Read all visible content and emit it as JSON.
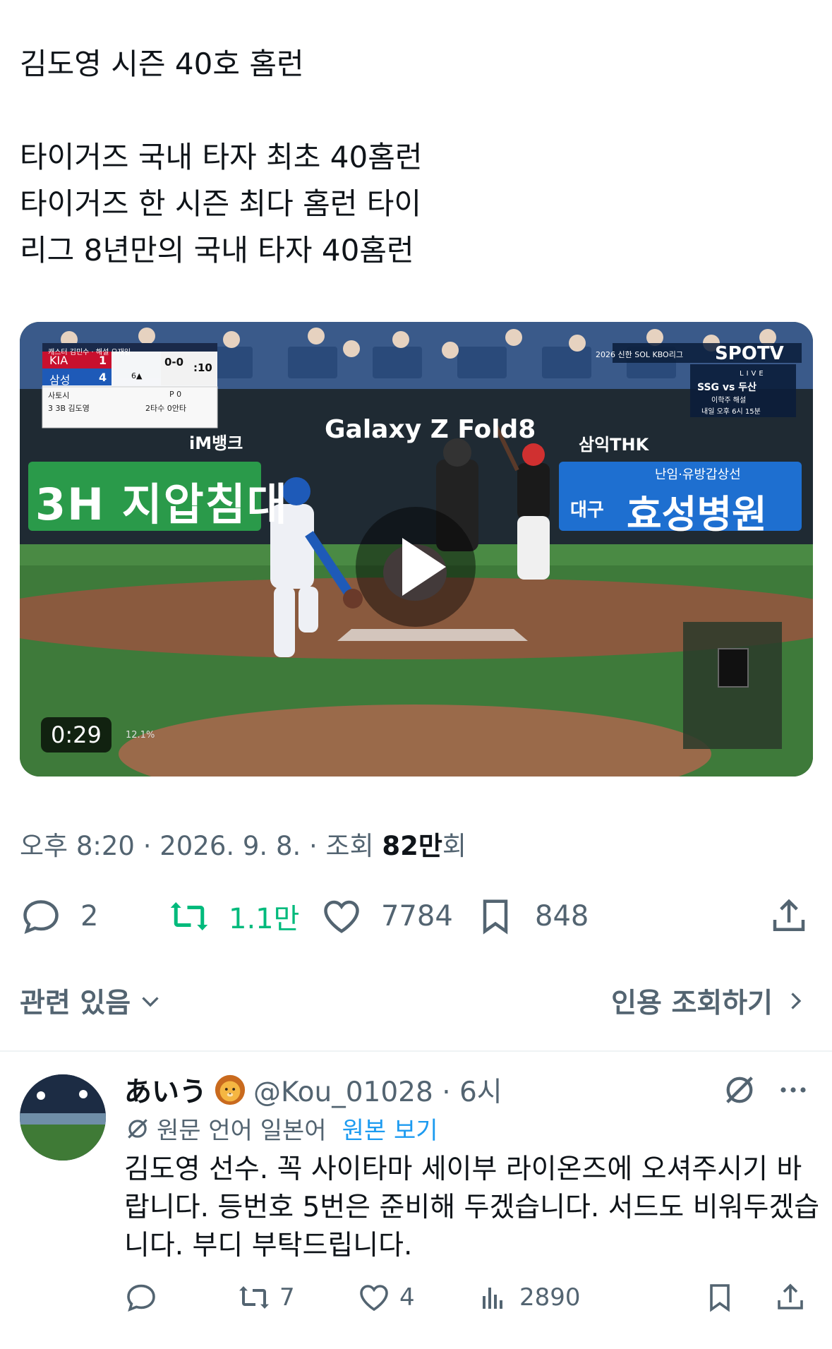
{
  "tweet": {
    "lines": [
      "김도영 시즌 40호 홈런",
      "타이거즈 국내 타자 최초 40홈런",
      "타이거즈 한 시즌 최다 홈런 타이",
      "리그 8년만의 국내 타자 40홈런"
    ],
    "video": {
      "duration": "0:29",
      "scoreboard": {
        "caster_line": "캐스터 김민수 · 해설 오재일",
        "team1": "KIA",
        "team1_score": "1",
        "team2": "삼성",
        "team2_score": "4",
        "count": "0-0",
        "outs_time": ":10",
        "inning": "6▲",
        "pitcher_label": "사토시",
        "pitcher_stat": "P 0",
        "batter_label": "3 3B 김도영",
        "batter_stat": "2타수 0안타"
      },
      "ads": {
        "left_board": "3H 지압침대",
        "bank": "iM뱅크",
        "center": "Galaxy Z Fold8",
        "thk": "삼익THK",
        "hospital_sub": "난임·유방갑상선",
        "hospital_city": "대구",
        "hospital_name": "효성병원"
      },
      "broadcast": {
        "league": "2026 신한 SOL KBO리그",
        "channel": "SPOTV",
        "live": "LIVE",
        "next_game": "SSG vs 두산",
        "next_commentator": "이학주 해설",
        "next_time": "내일 오후 6시 15분"
      },
      "speed_overlay": "12.1%"
    },
    "meta": {
      "time": "오후 8:20 · 2026. 9. 8. · 조회 ",
      "views_bold": "82만",
      "views_suffix": "회"
    },
    "actions": {
      "replies": "2",
      "retweets": "1.1만",
      "likes": "7784",
      "bookmarks": "848"
    },
    "related_label": "관련 있음",
    "quote_label": "인용 조회하기"
  },
  "reply": {
    "name": "あいう",
    "handle": "@Kou_01028 · 6시",
    "translated_from": "원문 언어 일본어",
    "show_original": "원본 보기",
    "lines": [
      "김도영 선수. 꼭 사이타마 세이부 라이온즈에 오셔주시기 바",
      "랍니다. 등번호 5번은 준비해 두겠습니다. 서드도 비워두겠습",
      "니다. 부디 부탁드립니다."
    ],
    "actions": {
      "retweets": "7",
      "likes": "4",
      "views": "2890"
    }
  },
  "colors": {
    "text": "#0f1419",
    "muted": "#536471",
    "retweet_green": "#00ba7c",
    "link_blue": "#1d9bf0"
  }
}
